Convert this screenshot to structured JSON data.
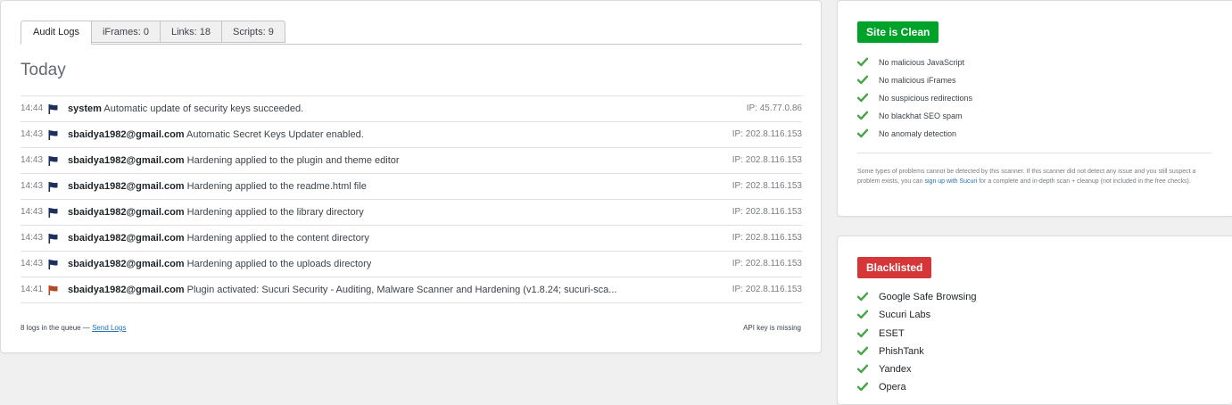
{
  "audit": {
    "tabs": [
      {
        "label": "Audit Logs",
        "active": true
      },
      {
        "label": "iFrames: 0",
        "active": false
      },
      {
        "label": "Links: 18",
        "active": false
      },
      {
        "label": "Scripts: 9",
        "active": false
      }
    ],
    "day_heading": "Today",
    "logs": [
      {
        "time": "14:44",
        "user": "system",
        "message": "Automatic update of security keys succeeded.",
        "ip": "IP: 45.77.0.86",
        "flag": "blue-flag-icon"
      },
      {
        "time": "14:43",
        "user": "sbaidya1982@gmail.com",
        "message": "Automatic Secret Keys Updater enabled.",
        "ip": "IP: 202.8.116.153",
        "flag": "blue-flag-icon"
      },
      {
        "time": "14:43",
        "user": "sbaidya1982@gmail.com",
        "message": "Hardening applied to the plugin and theme editor",
        "ip": "IP: 202.8.116.153",
        "flag": "blue-flag-icon"
      },
      {
        "time": "14:43",
        "user": "sbaidya1982@gmail.com",
        "message": "Hardening applied to the readme.html file",
        "ip": "IP: 202.8.116.153",
        "flag": "blue-flag-icon"
      },
      {
        "time": "14:43",
        "user": "sbaidya1982@gmail.com",
        "message": "Hardening applied to the library directory",
        "ip": "IP: 202.8.116.153",
        "flag": "blue-flag-icon"
      },
      {
        "time": "14:43",
        "user": "sbaidya1982@gmail.com",
        "message": "Hardening applied to the content directory",
        "ip": "IP: 202.8.116.153",
        "flag": "blue-flag-icon"
      },
      {
        "time": "14:43",
        "user": "sbaidya1982@gmail.com",
        "message": "Hardening applied to the uploads directory",
        "ip": "IP: 202.8.116.153",
        "flag": "blue-flag-icon"
      },
      {
        "time": "14:41",
        "user": "sbaidya1982@gmail.com",
        "message": "Plugin activated: Sucuri Security - Auditing, Malware Scanner and Hardening (v1.8.24; sucuri-sca...",
        "ip": "IP: 202.8.116.153",
        "flag": "orange-flag-icon"
      }
    ],
    "footer": {
      "queue_text": "8 logs in the queue —",
      "send_link": "Send Logs",
      "api_status": "API key is missing"
    }
  },
  "scan": {
    "status_label": "Site is Clean",
    "status_color": "#00a32a",
    "checks": [
      "No malicious JavaScript",
      "No malicious iFrames",
      "No suspicious redirections",
      "No blackhat SEO spam",
      "No anomaly detection"
    ],
    "notice_before": "Some types of problems cannot be detected by this scanner. If this scanner did not detect any issue and you still suspect a problem exists, you can",
    "notice_link": "sign up with Sucuri",
    "notice_after": "for a complete and in-depth scan + cleanup (not included in the free checks)."
  },
  "blacklist": {
    "status_label": "Blacklisted",
    "status_color": "#d63638",
    "items": [
      "Google Safe Browsing",
      "Sucuri Labs",
      "ESET",
      "PhishTank",
      "Yandex",
      "Opera"
    ]
  },
  "colors": {
    "check": "#46a547",
    "flag_blue": "#1d2f5c",
    "flag_orange": "#b04a26"
  }
}
